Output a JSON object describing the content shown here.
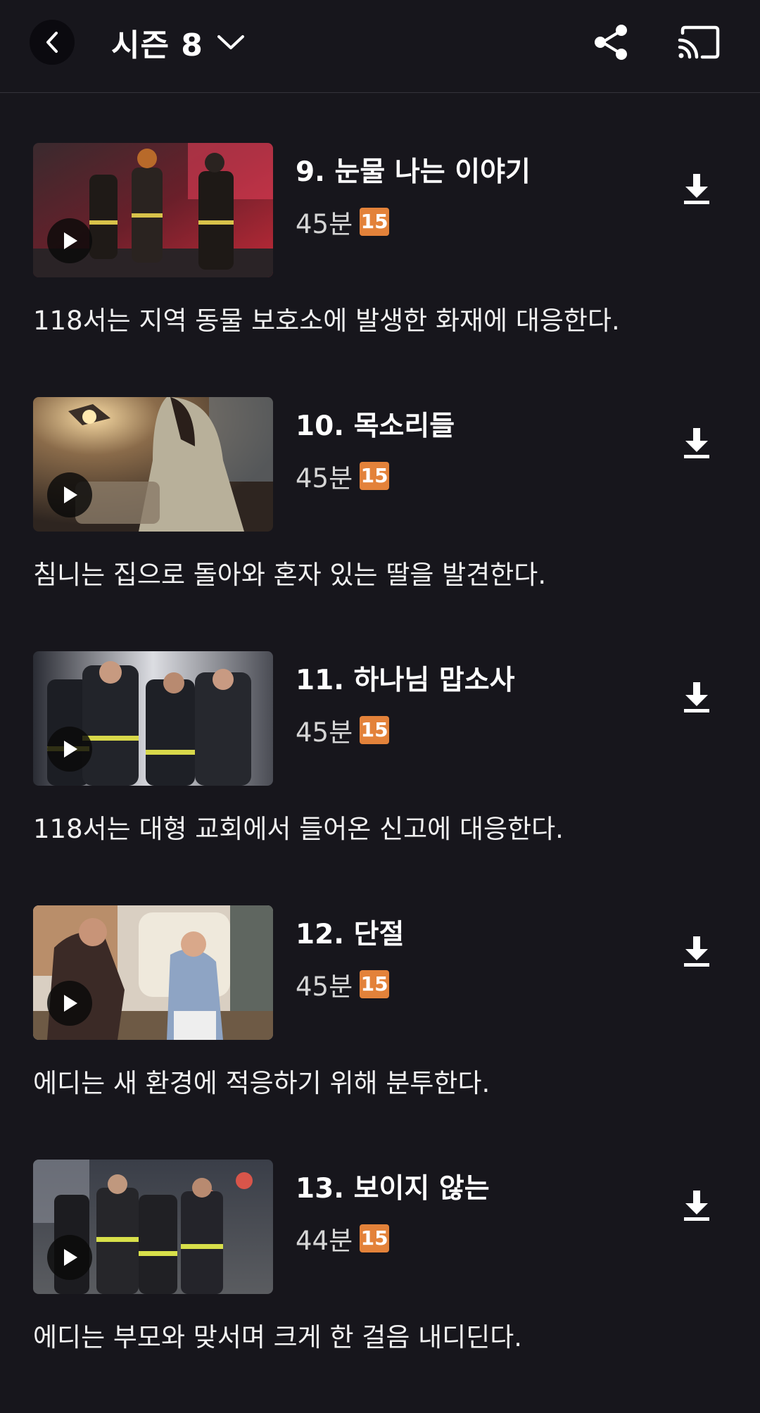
{
  "header": {
    "season_label": "시즌 8"
  },
  "episodes": [
    {
      "title": "9. 눈물 나는 이야기",
      "duration": "45분",
      "rating": "15",
      "synopsis": "118서는 지역 동물 보호소에 발생한 화재에 대응한다."
    },
    {
      "title": "10. 목소리들",
      "duration": "45분",
      "rating": "15",
      "synopsis": "침니는 집으로 돌아와 혼자 있는 딸을 발견한다."
    },
    {
      "title": "11. 하나님 맙소사",
      "duration": "45분",
      "rating": "15",
      "synopsis": "118서는 대형 교회에서 들어온 신고에 대응한다."
    },
    {
      "title": "12. 단절",
      "duration": "45분",
      "rating": "15",
      "synopsis": "에디는 새 환경에 적응하기 위해 분투한다."
    },
    {
      "title": "13. 보이지 않는",
      "duration": "44분",
      "rating": "15",
      "synopsis": "에디는 부모와 맞서며 크게 한 걸음 내디딘다."
    }
  ],
  "colors": {
    "background": "#17161c",
    "rating_badge": "#e3823a"
  },
  "icons": [
    "back-arrow-icon",
    "chevron-down-icon",
    "share-icon",
    "cast-icon",
    "play-icon",
    "download-icon"
  ]
}
